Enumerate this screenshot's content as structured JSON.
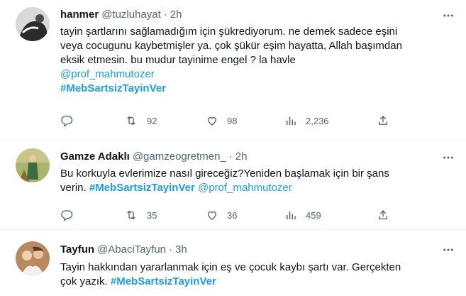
{
  "tweets": [
    {
      "name": "hanmer",
      "handle": "@tuzluhayat",
      "dot": "·",
      "time": "2h",
      "lines": [
        "tayin şartlarını sağlamadığım için şükrediyorum. ne demek sadece eşini",
        "veya cocugunu kaybetmişler ya. çok şükür eşim hayatta, Allah başımdan",
        "eksik etmesin. bu mudur tayinime engel ? la havle"
      ],
      "mention": "@prof_mahmutozer",
      "hashtag": "#MebSartsizTayinVer",
      "retweets": "92",
      "likes": "98",
      "views": "2,236"
    },
    {
      "name": "Gamze Adaklı",
      "handle": "@gamzeogretmen_",
      "dot": "·",
      "time": "2h",
      "line1": "Bu korkuyla evlerimize nasıl gireceğiz?Yeniden başlamak için bir şans",
      "line2_pre": "verin. ",
      "hashtag": "#MebSartsizTayinVer",
      "mention": " @prof_mahmutozer",
      "retweets": "35",
      "likes": "36",
      "views": "459"
    },
    {
      "name": "Tayfun",
      "handle": "@AbaciTayfun",
      "dot": "·",
      "time": "3h",
      "line1": "Tayin hakkından yararlanmak için eş ve çocuk kaybı şartı var. Gerçekten",
      "line2_pre": "çok yazık. ",
      "hashtag": "#MebSartsizTayinVer"
    }
  ],
  "icons": {
    "reply": "reply-icon",
    "retweet": "retweet-icon",
    "like": "heart-icon",
    "views": "views-icon",
    "share": "share-icon",
    "more": "more-icon"
  },
  "colors": {
    "link": "#1d9bf0",
    "text": "#0f1419",
    "muted": "#536471",
    "border": "#eff3f4"
  }
}
